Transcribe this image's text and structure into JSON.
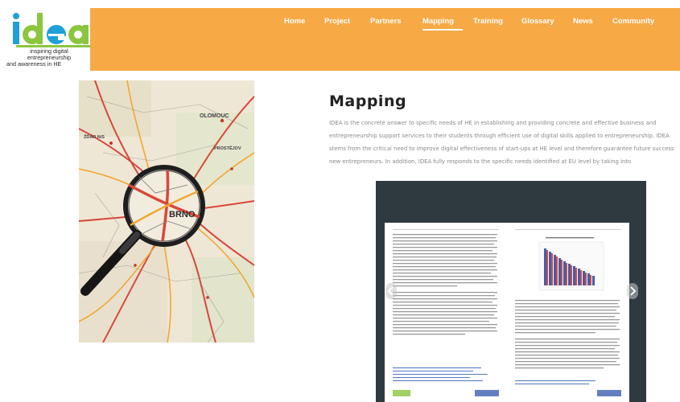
{
  "logo": {
    "mark": "idea",
    "tagline_lines": [
      "inspiring digital",
      "entrepreneurship",
      "and awareness in HE"
    ]
  },
  "nav": {
    "items": [
      "Home",
      "Project",
      "Partners",
      "Mapping",
      "Training",
      "Glossary",
      "News",
      "Community"
    ],
    "active": "Mapping"
  },
  "main": {
    "title": "Mapping",
    "intro": "IDEA is the concrete answer to specific needs of HE in establishing and providing concrete and effective business and entrepreneurship support services to their students through efficient use of digital skills applied to entrepreneurship. IDEA stems from the critical need to improve digital effectiveness of start-ups at HE level and therefore guarantee future success new entrepreneurs. In addition, IDEA fully responds to the specific needs identified at EU level by taking into"
  },
  "map_image": {
    "labels": [
      "OLOMOUC",
      "BRNO",
      "ŽĎÁR N/S",
      "PROSTĚJOV"
    ]
  },
  "slider": {
    "document_pages": [
      "left",
      "right"
    ],
    "prev_icon": "chevron-left-icon",
    "next_icon": "chevron-right-icon"
  },
  "colors": {
    "header_orange": "#f7a945",
    "logo_green": "#8cc63f",
    "logo_blue": "#1fa0d8",
    "slider_bg": "#2e3a40",
    "text_muted": "#8a8a8a"
  }
}
